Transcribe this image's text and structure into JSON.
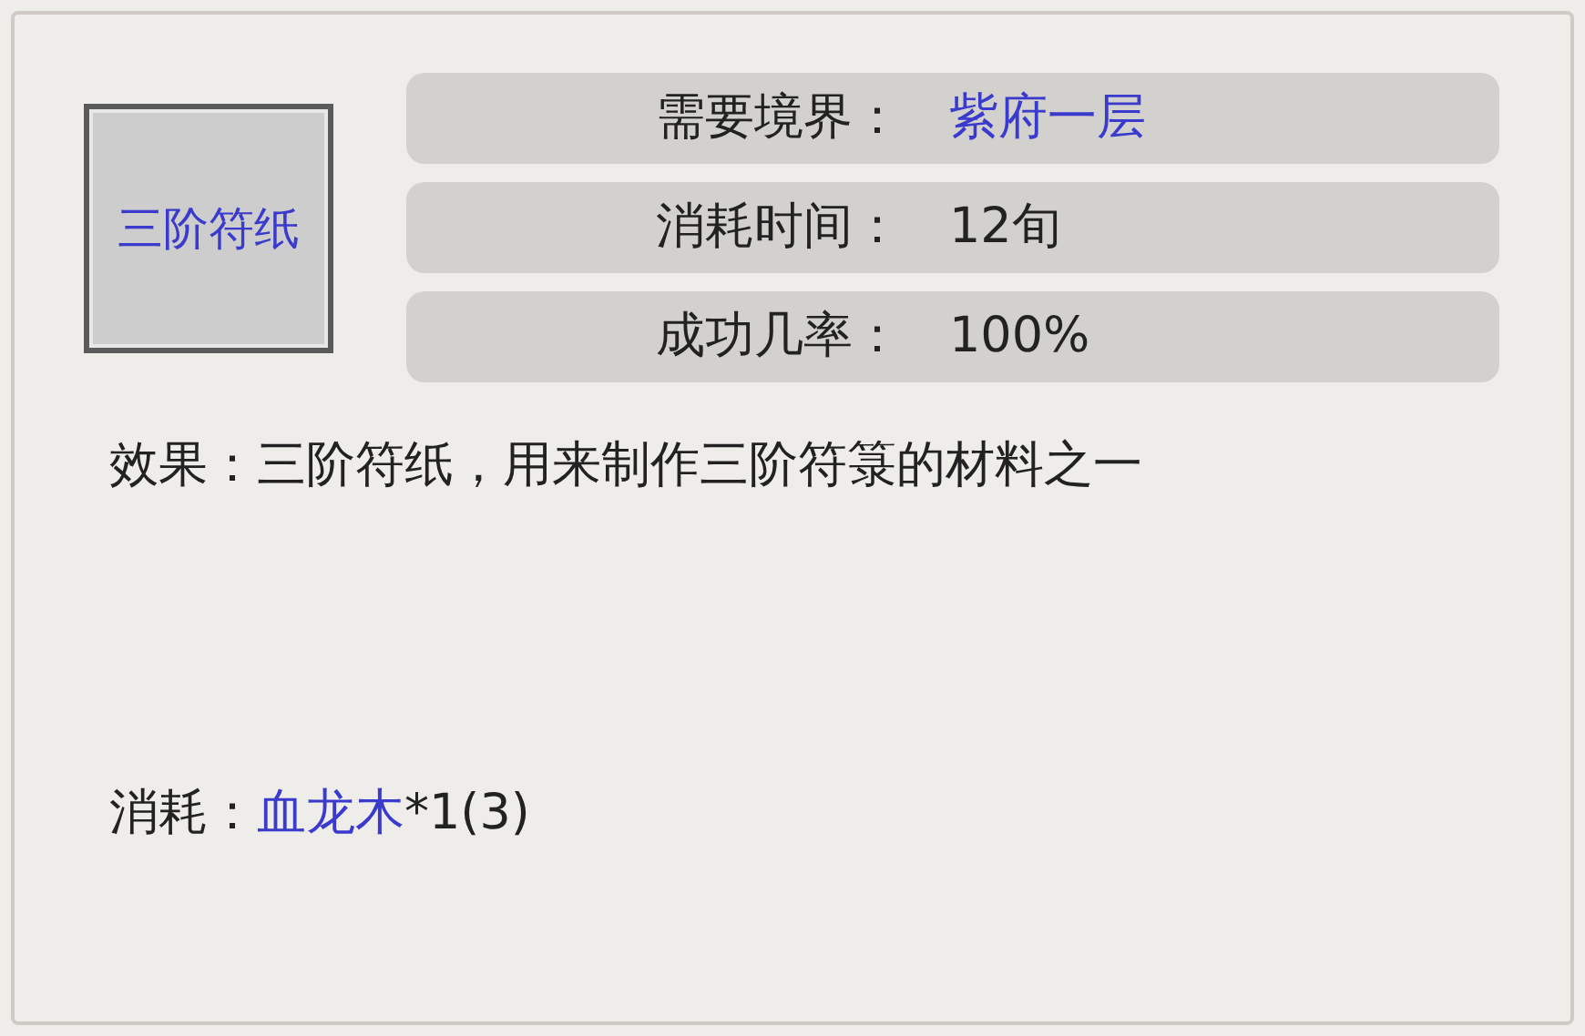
{
  "item": {
    "name": "三阶符纸"
  },
  "requirements": [
    {
      "label": "需要境界：",
      "value": "紫府一层",
      "color": "#3a3acc"
    },
    {
      "label": "消耗时间：",
      "value": "12旬",
      "color": "#222222"
    },
    {
      "label": "成功几率：",
      "value": "100%",
      "color": "#222222"
    }
  ],
  "effect": "效果：三阶符纸，用来制作三阶符箓的材料之一",
  "cost": {
    "label": "消耗：",
    "material": "血龙木",
    "amount": "*1(3)"
  }
}
